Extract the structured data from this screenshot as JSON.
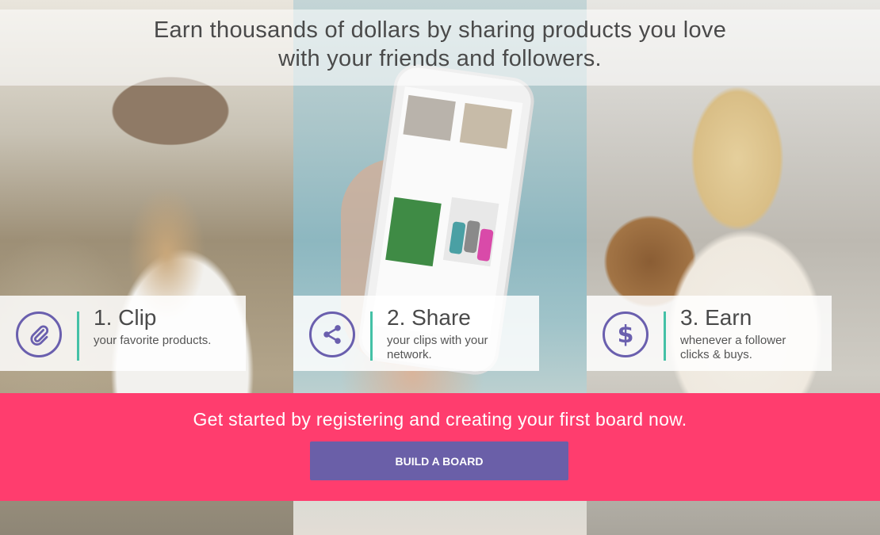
{
  "headline": {
    "line1": "Earn thousands of dollars by sharing products you love",
    "line2": "with your friends and followers."
  },
  "steps": [
    {
      "title": "1. Clip",
      "description": "your favorite products.",
      "icon": "paperclip-icon"
    },
    {
      "title": "2. Share",
      "description": "your clips with your network.",
      "icon": "share-icon"
    },
    {
      "title": "3. Earn",
      "description": "whenever a follower clicks & buys.",
      "icon": "dollar-icon"
    }
  ],
  "cta": {
    "text": "Get started by registering and creating your first board now.",
    "button_label": "BUILD A BOARD"
  },
  "colors": {
    "accent_pink": "#ff3d6e",
    "accent_purple": "#6a5fa8",
    "divider_teal": "#44c1a6"
  }
}
